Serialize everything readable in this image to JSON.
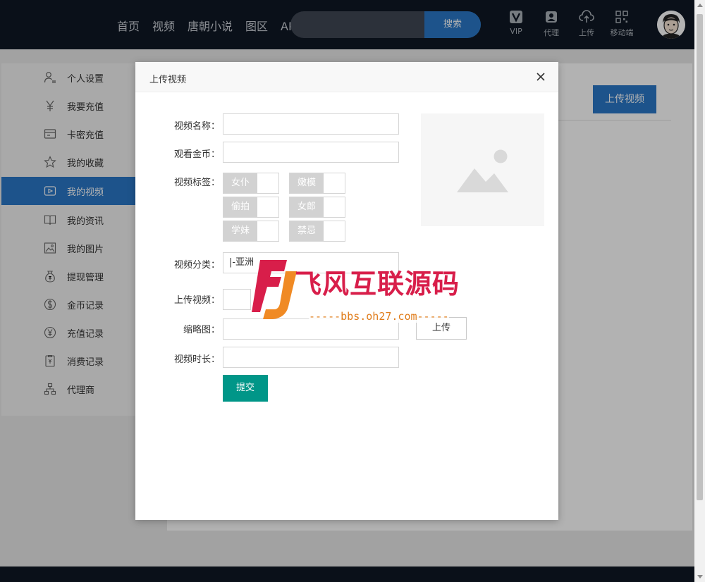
{
  "header": {
    "nav": [
      "首页",
      "视频",
      "唐朝小说",
      "图区",
      "APP下载"
    ],
    "search": {
      "placeholder": "",
      "button": "搜索"
    },
    "icons": [
      {
        "label": "VIP",
        "icon": "vip-icon"
      },
      {
        "label": "代理",
        "icon": "agent-icon"
      },
      {
        "label": "上传",
        "icon": "upload-cloud-icon"
      },
      {
        "label": "移动端",
        "icon": "qrcode-icon"
      }
    ]
  },
  "sidebar": {
    "items": [
      {
        "label": "个人设置",
        "icon": "user-settings-icon"
      },
      {
        "label": "我要充值",
        "icon": "yen-icon"
      },
      {
        "label": "卡密充值",
        "icon": "card-icon"
      },
      {
        "label": "我的收藏",
        "icon": "star-icon"
      },
      {
        "label": "我的视频",
        "icon": "video-icon",
        "active": true
      },
      {
        "label": "我的资讯",
        "icon": "book-icon"
      },
      {
        "label": "我的图片",
        "icon": "image-icon"
      },
      {
        "label": "提现管理",
        "icon": "money-bag-icon"
      },
      {
        "label": "金币记录",
        "icon": "dollar-icon"
      },
      {
        "label": "充值记录",
        "icon": "yen-circle-icon"
      },
      {
        "label": "消费记录",
        "icon": "receipt-icon"
      },
      {
        "label": "代理商",
        "icon": "network-icon"
      }
    ]
  },
  "main": {
    "upload_button": "上传视频"
  },
  "modal": {
    "title": "上传视频",
    "fields": {
      "name": {
        "label": "视频名称：",
        "value": ""
      },
      "coins": {
        "label": "观看金币：",
        "value": ""
      },
      "tags_label": "视频标签：",
      "tags": [
        "女仆",
        "嫩模",
        "偷拍",
        "女郎",
        "学妹",
        "禁忌"
      ],
      "category": {
        "label": "视频分类：",
        "value": "|-亚洲"
      },
      "upload": {
        "label": "上传视频："
      },
      "thumbnail": {
        "label": "缩略图：",
        "value": "",
        "button": "上传"
      },
      "duration": {
        "label": "视频时长：",
        "value": ""
      }
    },
    "submit": "提交"
  },
  "watermark": {
    "title": "飞风互联源码",
    "url": "-----bbs.oh27.com-----"
  },
  "colors": {
    "header_bg": "#0f1724",
    "accent_blue": "#2a78c8",
    "submit_green": "#009688",
    "watermark_red": "#d81e4a",
    "watermark_orange": "#f08a24"
  }
}
